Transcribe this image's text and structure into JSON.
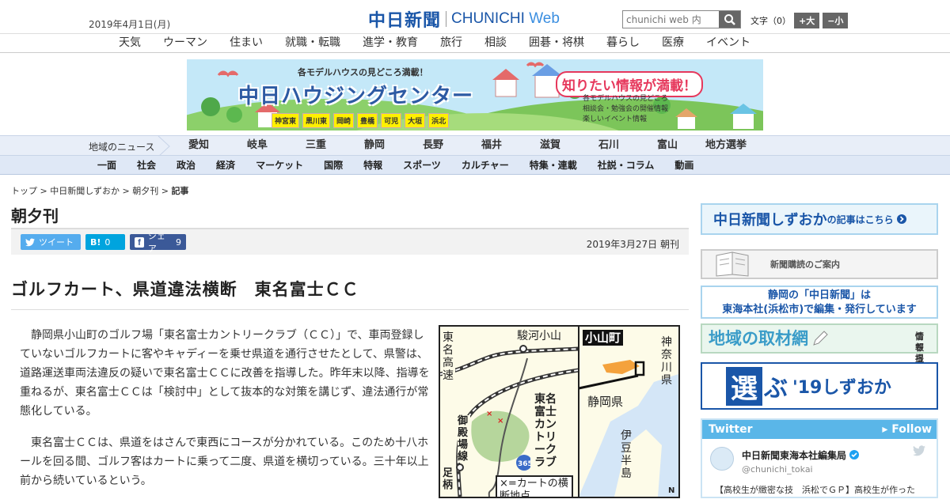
{
  "header": {
    "date": "2019年4月1日(月)",
    "logo_jp": "中日新聞",
    "logo_en_1": "CHUNICHI",
    "logo_en_2": "Web",
    "search_placeholder": "chunichi web 内",
    "font_size_label": "文字（0）",
    "font_larger": "+大",
    "font_smaller": "−小"
  },
  "top_nav": [
    "天気",
    "ウーマン",
    "住まい",
    "就職・転職",
    "進学・教育",
    "旅行",
    "相談",
    "囲碁・将棋",
    "暮らし",
    "医療",
    "イベント"
  ],
  "banner": {
    "subtitle": "各モデルハウスの見どころ満載！",
    "title": "中日ハウジングセンター",
    "bubble": "知りたい情報が満載！",
    "list": [
      "各モデルハウスの見どころ",
      "相談会・勉強会の開催情報",
      "楽しいイベント情報"
    ],
    "tags": [
      "神宮東",
      "黒川東",
      "岡崎",
      "豊橋",
      "可児",
      "大垣",
      "浜北"
    ]
  },
  "region_nav": {
    "label": "地域のニュース",
    "items": [
      "愛知",
      "岐阜",
      "三重",
      "静岡",
      "長野",
      "福井",
      "滋賀",
      "石川",
      "富山",
      "地方選挙"
    ]
  },
  "category_nav": [
    "一面",
    "社会",
    "政治",
    "経済",
    "マーケット",
    "国際",
    "特報",
    "スポーツ",
    "カルチャー",
    "特集・連載",
    "社説・コラム",
    "動画"
  ],
  "breadcrumb": {
    "items": [
      "トップ",
      "中日新聞しずおか",
      "朝夕刊"
    ],
    "current": "記事",
    "sep": ">"
  },
  "section_title": "朝夕刊",
  "share": {
    "tweet_label": "ツイート",
    "hatena_label": "B!",
    "hatena_count": "0",
    "fb_label": "シェア",
    "fb_count": "9",
    "pub_date": "2019年3月27日 朝刊"
  },
  "article": {
    "headline": "ゴルフカート、県道違法横断　東名富士ＣＣ",
    "paragraphs": [
      "静岡県小山町のゴルフ場「東名富士カントリークラブ（ＣＣ）」で、車両登録していないゴルフカートに客やキャディーを乗せ県道を通行させたとして、県警は、道路運送車両法違反の疑いで東名富士ＣＣに改善を指導した。昨年末以降、指導を重ねるが、東名富士ＣＣは「検討中」として抜本的な対策を講じず、違法通行が常態化している。",
      "東名富士ＣＣは、県道をはさんで東西にコースが分かれている。このため十八ホールを回る間、ゴルフ客はカートに乗って二度、県道を横切っている。三十年以上前から続いているという。"
    ]
  },
  "map": {
    "labels": {
      "station": "駿河小山",
      "expressway": "東名高速",
      "club": "東名富士カントリークラブ",
      "line": "御殿場線",
      "ashigara": "足柄",
      "route": "365",
      "town": "小山町",
      "kanagawa": "神奈川県",
      "shizuoka": "静岡県",
      "izu": "伊豆半島",
      "legend": "×=カートの横断地点",
      "north": "N"
    }
  },
  "sidebar": {
    "shizuoka_link": "中日新聞しずおか",
    "shizuoka_link_sub": "の記事はこちら",
    "subscribe": "新聞購読",
    "subscribe_sub": "のご案内",
    "hq_line1": "静岡の「中日新聞」は",
    "hq_line2": "東海本社(浜松市)で編集・発行しています",
    "local_news": "地域の取材網",
    "local_news_sub1": "情報提供は",
    "local_news_sub2": "こちらへ",
    "election_char": "選",
    "election_rest": "ぶ",
    "election_year": "'19しずおか"
  },
  "twitter": {
    "title": "Twitter",
    "follow": "Follow",
    "account_name": "中日新聞東海本社編集局",
    "handle": "@chunichi_tokai",
    "preview": "【高校生が緻密な技　浜松でＧＰ】高校生が作った"
  },
  "colors": {
    "brand_blue": "#1a56a8",
    "twitter_blue": "#5ab6e8",
    "facebook_blue": "#3b5998",
    "hatena_blue": "#00a4de"
  }
}
